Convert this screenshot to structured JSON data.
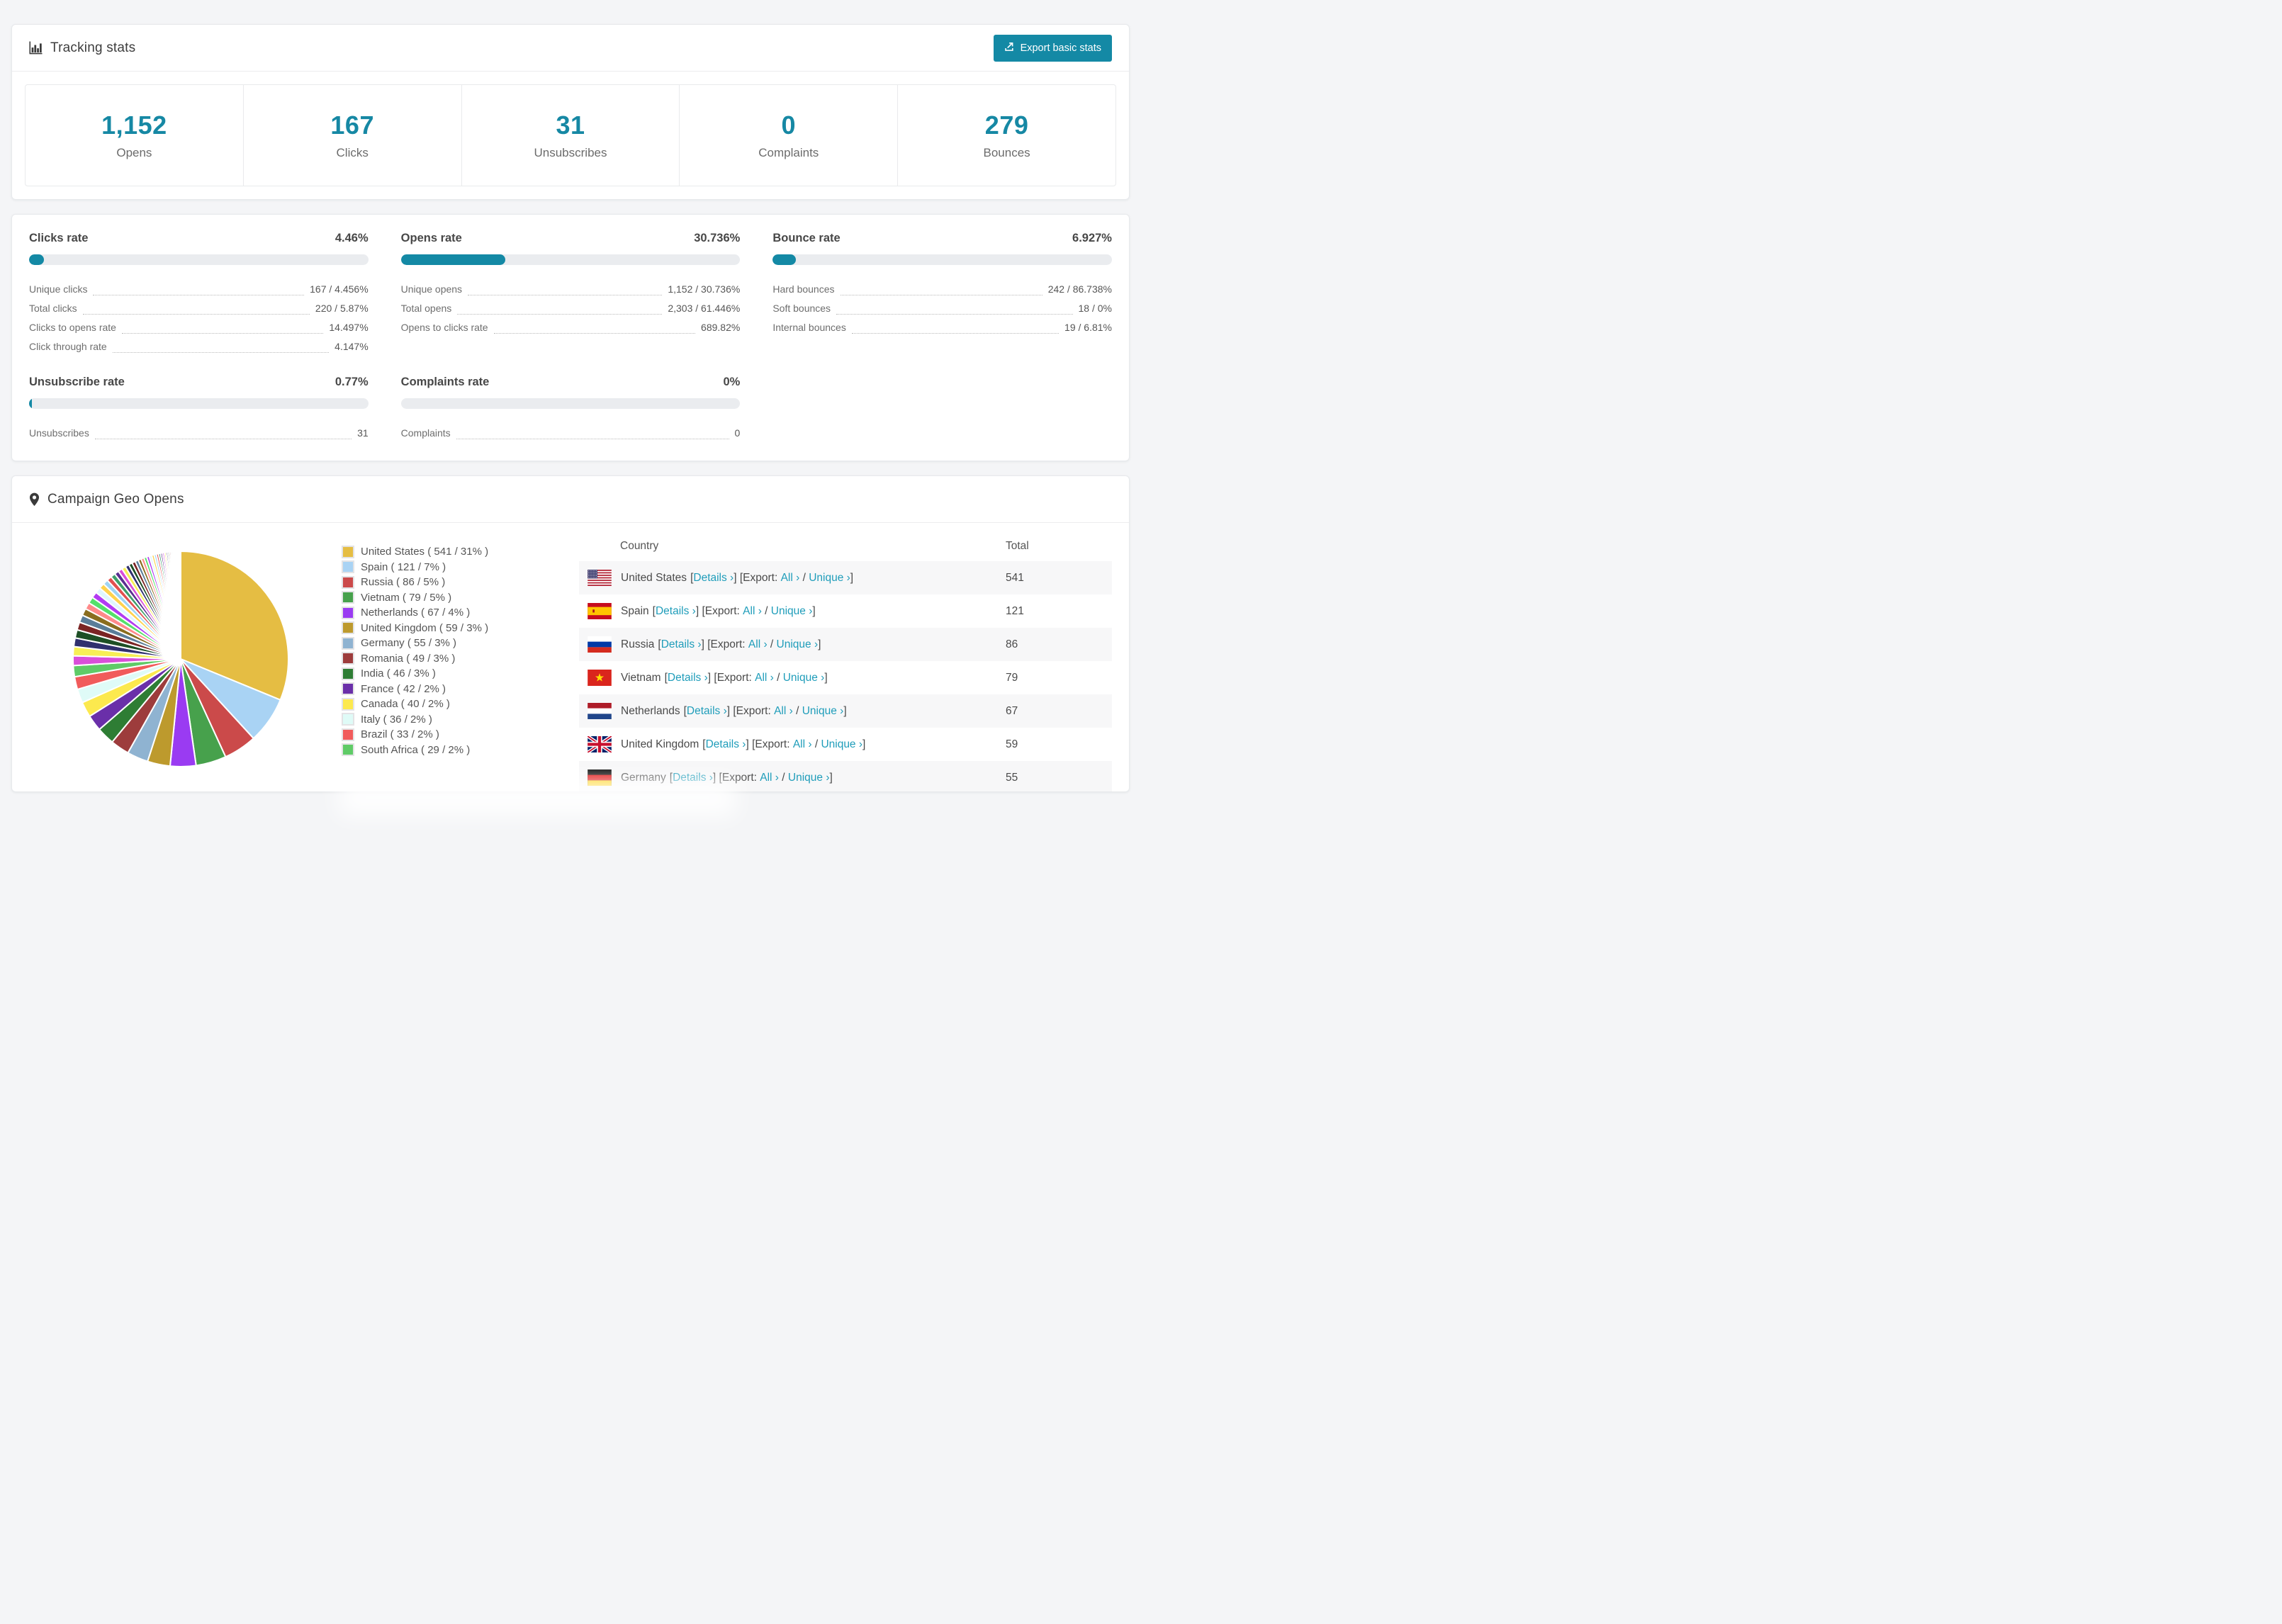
{
  "header": {
    "title": "Tracking stats",
    "export_button": "Export basic stats"
  },
  "summary": [
    {
      "value": "1,152",
      "label": "Opens"
    },
    {
      "value": "167",
      "label": "Clicks"
    },
    {
      "value": "31",
      "label": "Unsubscribes"
    },
    {
      "value": "0",
      "label": "Complaints"
    },
    {
      "value": "279",
      "label": "Bounces"
    }
  ],
  "rates": [
    {
      "title": "Clicks rate",
      "value": "4.46%",
      "percent": 4.46,
      "rows": [
        [
          "Unique clicks",
          "167 / 4.456%"
        ],
        [
          "Total clicks",
          "220 / 5.87%"
        ],
        [
          "Clicks to opens rate",
          "14.497%"
        ],
        [
          "Click through rate",
          "4.147%"
        ]
      ]
    },
    {
      "title": "Opens rate",
      "value": "30.736%",
      "percent": 30.736,
      "rows": [
        [
          "Unique opens",
          "1,152 / 30.736%"
        ],
        [
          "Total opens",
          "2,303 / 61.446%"
        ],
        [
          "Opens to clicks rate",
          "689.82%"
        ]
      ]
    },
    {
      "title": "Bounce rate",
      "value": "6.927%",
      "percent": 6.927,
      "rows": [
        [
          "Hard bounces",
          "242 / 86.738%"
        ],
        [
          "Soft bounces",
          "18 / 0%"
        ],
        [
          "Internal bounces",
          "19 / 6.81%"
        ]
      ]
    },
    {
      "title": "Unsubscribe rate",
      "value": "0.77%",
      "percent": 0.77,
      "rows": [
        [
          "Unsubscribes",
          "31"
        ]
      ]
    },
    {
      "title": "Complaints rate",
      "value": "0%",
      "percent": 0,
      "rows": [
        [
          "Complaints",
          "0"
        ]
      ]
    }
  ],
  "geo": {
    "title": "Campaign Geo Opens",
    "chart_data": {
      "type": "pie",
      "title": "Campaign Geo Opens",
      "legend_position": "right",
      "slices": [
        {
          "label": "United States",
          "value": 541,
          "display": "United States ( 541 / 31% )",
          "color": "#e5bd43",
          "flag": "us"
        },
        {
          "label": "Spain",
          "value": 121,
          "display": "Spain ( 121 / 7% )",
          "color": "#a9d3f4",
          "flag": "es"
        },
        {
          "label": "Russia",
          "value": 86,
          "display": "Russia ( 86 / 5% )",
          "color": "#cb4a4a",
          "flag": "ru"
        },
        {
          "label": "Vietnam",
          "value": 79,
          "display": "Vietnam ( 79 / 5% )",
          "color": "#47a14c",
          "flag": "vn"
        },
        {
          "label": "Netherlands",
          "value": 67,
          "display": "Netherlands ( 67 / 4% )",
          "color": "#9a3bf2",
          "flag": "nl"
        },
        {
          "label": "United Kingdom",
          "value": 59,
          "display": "United Kingdom ( 59 / 3% )",
          "color": "#bd9a2d",
          "flag": "gb"
        },
        {
          "label": "Germany",
          "value": 55,
          "display": "Germany ( 55 / 3% )",
          "color": "#8fb3d1",
          "flag": "de"
        },
        {
          "label": "Romania",
          "value": 49,
          "display": "Romania ( 49 / 3% )",
          "color": "#9d3c3c"
        },
        {
          "label": "India",
          "value": 46,
          "display": "India ( 46 / 3% )",
          "color": "#2e7d34"
        },
        {
          "label": "France",
          "value": 42,
          "display": "France ( 42 / 2% )",
          "color": "#6a2fa9"
        },
        {
          "label": "Canada",
          "value": 40,
          "display": "Canada ( 40 / 2% )",
          "color": "#fce94e"
        },
        {
          "label": "Italy",
          "value": 36,
          "display": "Italy ( 36 / 2% )",
          "color": "#dffbf7"
        },
        {
          "label": "Brazil",
          "value": 33,
          "display": "Brazil ( 33 / 2% )",
          "color": "#f15b5b"
        },
        {
          "label": "South Africa",
          "value": 29,
          "display": "South Africa ( 29 / 2% )",
          "color": "#5fcb67"
        }
      ],
      "tail": {
        "count": 45,
        "start": 25,
        "ratio": 0.95,
        "palette": [
          "#d94fd9",
          "#f7ef55",
          "#30306e",
          "#1d4f25",
          "#7a2424",
          "#5a7d99",
          "#8a6d1f",
          "#ff8a8a",
          "#55e06a",
          "#b23bf2",
          "#dff6ff",
          "#ffd24d",
          "#9fd4f5",
          "#e34f4f",
          "#3f9e6a",
          "#5a2d91"
        ]
      }
    },
    "table": {
      "headers": [
        "Country",
        "Total"
      ],
      "labels": {
        "details": "Details ›",
        "export": "[Export:",
        "all": "All ›",
        "unique": "Unique ›",
        "sep": "/",
        "lb": "[",
        "rb": "]"
      },
      "rows": [
        {
          "country": "United States",
          "flag": "us",
          "total": "541"
        },
        {
          "country": "Spain",
          "flag": "es",
          "total": "121"
        },
        {
          "country": "Russia",
          "flag": "ru",
          "total": "86"
        },
        {
          "country": "Vietnam",
          "flag": "vn",
          "total": "79"
        },
        {
          "country": "Netherlands",
          "flag": "nl",
          "total": "67"
        },
        {
          "country": "United Kingdom",
          "flag": "gb",
          "total": "59"
        },
        {
          "country": "Germany",
          "flag": "de",
          "total": "55"
        }
      ]
    }
  },
  "colors": {
    "accent": "#1489a5",
    "link": "#1f9dba",
    "track": "#eaecef",
    "stripe": "#f7f7f8"
  }
}
